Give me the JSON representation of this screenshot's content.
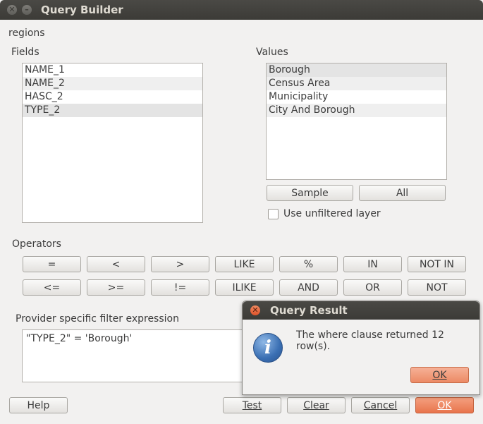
{
  "window": {
    "title": "Query Builder",
    "layer_name": "regions"
  },
  "fields": {
    "label": "Fields",
    "items": [
      "NAME_1",
      "NAME_2",
      "HASC_2",
      "TYPE_2"
    ],
    "selected": "TYPE_2"
  },
  "values": {
    "label": "Values",
    "items": [
      "Borough",
      "Census Area",
      "Municipality",
      "City And Borough"
    ],
    "selected": "Borough",
    "sample_button": "Sample",
    "all_button": "All",
    "unfiltered_label": "Use unfiltered layer",
    "unfiltered_checked": false
  },
  "operators": {
    "label": "Operators",
    "row1": [
      "=",
      "<",
      ">",
      "LIKE",
      "%",
      "IN",
      "NOT IN"
    ],
    "row2": [
      "<=",
      ">=",
      "!=",
      "ILIKE",
      "AND",
      "OR",
      "NOT"
    ]
  },
  "filter": {
    "label": "Provider specific filter expression",
    "expression": "\"TYPE_2\" = 'Borough'"
  },
  "buttons": {
    "help": "Help",
    "test": "Test",
    "clear": "Clear",
    "cancel": "Cancel",
    "ok": "OK"
  },
  "dialog": {
    "title": "Query Result",
    "message": "The where clause returned 12 row(s).",
    "ok": "OK"
  },
  "colors": {
    "accent_orange": "#e8744c",
    "titlebar": "#3c3b37",
    "info_blue": "#3a6fb3"
  }
}
